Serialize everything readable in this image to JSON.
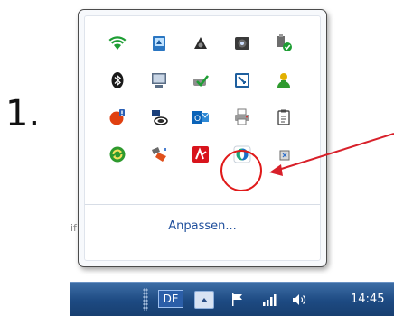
{
  "step": {
    "number": "1."
  },
  "flyout": {
    "icons": [
      {
        "name": "wifi-icon"
      },
      {
        "name": "network-manager-icon"
      },
      {
        "name": "speaker-wizard-icon"
      },
      {
        "name": "webcam-icon"
      },
      {
        "name": "usb-safe-icon"
      },
      {
        "name": "bluetooth-icon"
      },
      {
        "name": "display-icon"
      },
      {
        "name": "sync-check-icon"
      },
      {
        "name": "settings-window-icon"
      },
      {
        "name": "user-agent-icon"
      },
      {
        "name": "update-alert-icon"
      },
      {
        "name": "sound-manager-icon"
      },
      {
        "name": "outlook-icon"
      },
      {
        "name": "printer-icon"
      },
      {
        "name": "clipboard-icon"
      },
      {
        "name": "refresh-icon"
      },
      {
        "name": "safely-remove-icon"
      },
      {
        "name": "antivirus-icon"
      },
      {
        "name": "target-app-icon"
      },
      {
        "name": "dropbox-icon"
      }
    ],
    "customize_label": "Anpassen..."
  },
  "taskbar": {
    "language": "DE",
    "time": "14:45"
  },
  "background": {
    "fragment_left": "if"
  },
  "colors": {
    "taskbar": "#1d4a82",
    "highlight": "#e01a1a",
    "link": "#1e4e9c"
  }
}
